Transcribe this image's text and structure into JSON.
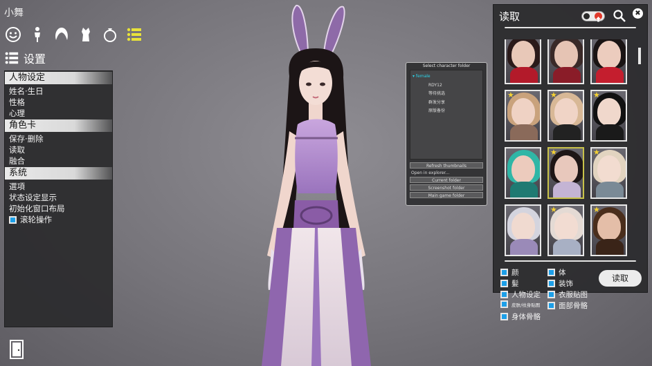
{
  "character_name": "小舞",
  "toolbar_icons": [
    "smiley-face-icon",
    "body-icon",
    "hair-icon",
    "clothing-icon",
    "ring-accessory-icon",
    "list-settings-icon"
  ],
  "section": {
    "title": "设置"
  },
  "left_menu": {
    "groups": [
      {
        "header": "人物设定",
        "items": [
          "姓名·生日",
          "性格",
          "心理"
        ]
      },
      {
        "header": "角色卡",
        "items": [
          "保存·删除",
          "读取",
          "融合"
        ]
      },
      {
        "header": "系统",
        "items": [
          "選項",
          "状态设定显示",
          "初始化窗口布局"
        ]
      }
    ],
    "wheel_option": "滚轮操作"
  },
  "folder_panel": {
    "title": "Select character folder",
    "tree": [
      "female",
      "RDY12",
      "等待挑选",
      "群发分享",
      "原版备份"
    ],
    "refresh_btn": "Refresh thumbnails",
    "open_label": "Open in explorer...",
    "buttons": [
      "Current folder",
      "Screenshot folder",
      "Main game folder"
    ]
  },
  "load_panel": {
    "title": "读取",
    "close": "✖",
    "load_button": "读取",
    "options_left": [
      "颜",
      "髪",
      "人物设定",
      "皮肤/纹身贴图",
      "身体骨骼"
    ],
    "options_right": [
      "体",
      "装饰",
      "衣服贴图",
      "面部骨骼"
    ],
    "cards": [
      {
        "star": false,
        "selected": false,
        "hair": "#2a1a1a",
        "skin": "#e8c8b8",
        "outfit": "#b31a2a"
      },
      {
        "star": false,
        "selected": false,
        "hair": "#3a2a28",
        "skin": "#e6c4b4",
        "outfit": "#8a1c28"
      },
      {
        "star": false,
        "selected": false,
        "hair": "#1a1414",
        "skin": "#ecccbe",
        "outfit": "#c41e2e"
      },
      {
        "star": true,
        "selected": false,
        "hair": "#c9a27c",
        "skin": "#efd2c4",
        "outfit": "#8a6a5a"
      },
      {
        "star": true,
        "selected": false,
        "hair": "#d8b896",
        "skin": "#f0d4c6",
        "outfit": "#222"
      },
      {
        "star": true,
        "selected": false,
        "hair": "#111",
        "skin": "#f0d8cc",
        "outfit": "#1a1a1a"
      },
      {
        "star": false,
        "selected": false,
        "hair": "#2fb6a6",
        "skin": "#eccbbd",
        "outfit": "#1f7a72"
      },
      {
        "star": true,
        "selected": true,
        "hair": "#1e1616",
        "skin": "#e8c8bc",
        "outfit": "#c4b4d4"
      },
      {
        "star": true,
        "selected": false,
        "hair": "#e2d4c0",
        "skin": "#f2dcd0",
        "outfit": "#7a8a96"
      },
      {
        "star": false,
        "selected": false,
        "hair": "#d4d4de",
        "skin": "#f0dad0",
        "outfit": "#9a8ab8"
      },
      {
        "star": true,
        "selected": false,
        "hair": "#e4dad4",
        "skin": "#f2dcd2",
        "outfit": "#a8b0c4"
      },
      {
        "star": true,
        "selected": false,
        "hair": "#4a2e1c",
        "skin": "#e4bea8",
        "outfit": "#3a2418"
      },
      {
        "star": false,
        "selected": false,
        "hair": "#888",
        "skin": "#bbb",
        "outfit": "#666"
      },
      {
        "star": false,
        "selected": false,
        "hair": "#888",
        "skin": "#bbb",
        "outfit": "#666"
      },
      {
        "star": false,
        "selected": false,
        "hair": "#888",
        "skin": "#bbb",
        "outfit": "#666"
      }
    ]
  }
}
